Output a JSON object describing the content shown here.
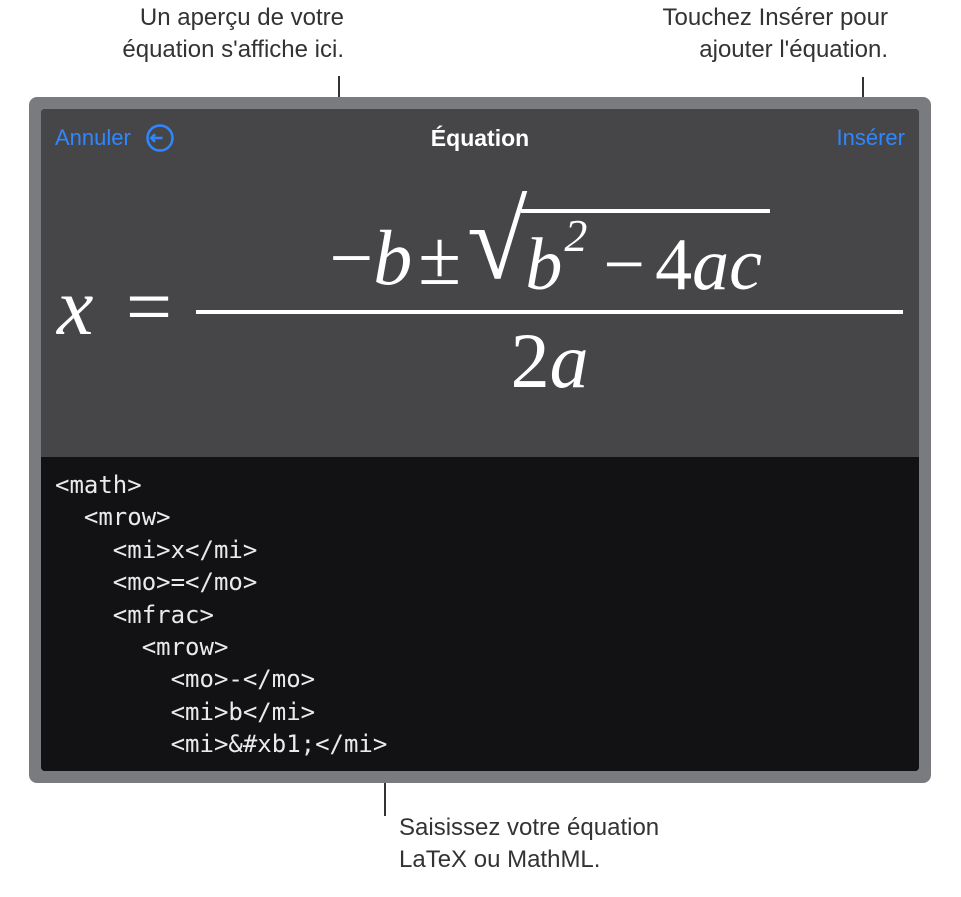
{
  "callouts": {
    "preview": "Un aperçu de votre équation s'affiche ici.",
    "insert_hint": "Touchez Insérer pour ajouter l'équation.",
    "code_hint": "Saisissez votre équation LaTeX ou MathML."
  },
  "toolbar": {
    "cancel_label": "Annuler",
    "title": "Équation",
    "insert_label": "Insérer"
  },
  "preview": {
    "x": "x",
    "eq": "=",
    "minus": "−",
    "b": "b",
    "pm": "±",
    "b2_base": "b",
    "b2_exp": "2",
    "minus2": "−",
    "four": "4",
    "a": "a",
    "c": "c",
    "den_two": "2",
    "den_a": "a"
  },
  "code": "<math>\n  <mrow>\n    <mi>x</mi>\n    <mo>=</mo>\n    <mfrac>\n      <mrow>\n        <mo>-</mo>\n        <mi>b</mi>\n        <mi>&#xb1;</mi>"
}
